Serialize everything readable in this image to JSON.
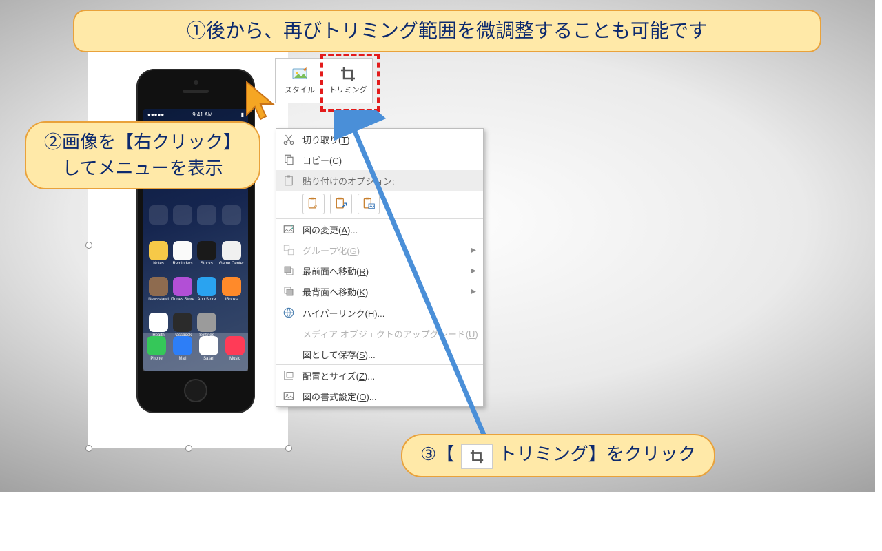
{
  "callouts": {
    "c1": "①後から、再びトリミング範囲を微調整することも可能です",
    "c2_line1": "②画像を【右クリック】",
    "c2_line2": "してメニューを表示",
    "c3_pre": "③【",
    "c3_label": "トリミング】をクリック"
  },
  "mini_toolbar": {
    "style": "スタイル",
    "trim": "トリミング"
  },
  "context_menu": {
    "cut": "切り取り(",
    "cut_k": "T",
    "cut_end": ")",
    "copy_pre": "コピー(",
    "copy_k": "C",
    "copy_end": ")",
    "paste_header": "貼り付けのオプション:",
    "change_pic": "図の変更(",
    "change_pic_k": "A",
    "change_pic_end": ")...",
    "group": "グループ化(",
    "group_k": "G",
    "group_end": ")",
    "front": "最前面へ移動(",
    "front_k": "R",
    "front_end": ")",
    "back": "最背面へ移動(",
    "back_k": "K",
    "back_end": ")",
    "hyperlink": "ハイパーリンク(",
    "hyperlink_k": "H",
    "hyperlink_end": ")...",
    "media_upgrade": "メディア オブジェクトのアップグレード(",
    "media_upgrade_k": "U",
    "media_upgrade_end": ")",
    "save_as": "図として保存(",
    "save_as_k": "S",
    "save_as_end": ")...",
    "size": "配置とサイズ(",
    "size_k": "Z",
    "size_end": ")...",
    "format": "図の書式設定(",
    "format_k": "O",
    "format_end": ")..."
  },
  "phone": {
    "time": "9:41 AM",
    "apps_row3": [
      "Notes",
      "Reminders",
      "Stocks",
      "Game Center"
    ],
    "apps_row4": [
      "Newsstand",
      "iTunes Store",
      "App Store",
      "iBooks"
    ],
    "apps_row5": [
      "Health",
      "Passbook",
      "Settings",
      ""
    ],
    "dock": [
      "Phone",
      "Mail",
      "Safari",
      "Music"
    ]
  },
  "colors": {
    "app_tiles_row3": [
      "#f6c948",
      "#fafafa",
      "#1a1a1a",
      "#f0f0f0"
    ],
    "app_tiles_row4": [
      "#8e6b4f",
      "#b24fd6",
      "#2aa3f0",
      "#ff8a2a"
    ],
    "app_tiles_row5": [
      "#ffffff",
      "#2b2b2b",
      "#9b9b9b",
      "transparent"
    ],
    "dock_tiles": [
      "#35c759",
      "#2d7ef7",
      "#ffffff",
      "#ff3b57"
    ]
  }
}
